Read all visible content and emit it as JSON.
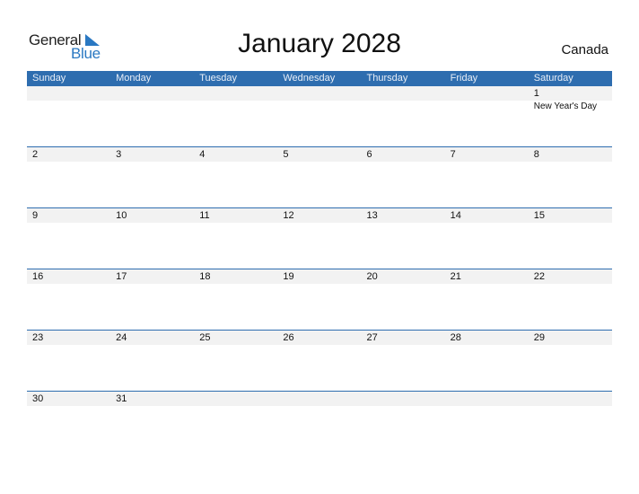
{
  "logo": {
    "general": "General",
    "blue": "Blue"
  },
  "title": "January 2028",
  "country": "Canada",
  "colors": {
    "header_bg": "#2e6daf",
    "brand_blue": "#2a78c2",
    "band": "#f2f2f2"
  },
  "weekdays": [
    "Sunday",
    "Monday",
    "Tuesday",
    "Wednesday",
    "Thursday",
    "Friday",
    "Saturday"
  ],
  "weeks": [
    [
      {
        "d": ""
      },
      {
        "d": ""
      },
      {
        "d": ""
      },
      {
        "d": ""
      },
      {
        "d": ""
      },
      {
        "d": ""
      },
      {
        "d": "1",
        "h": "New Year's Day"
      }
    ],
    [
      {
        "d": "2"
      },
      {
        "d": "3"
      },
      {
        "d": "4"
      },
      {
        "d": "5"
      },
      {
        "d": "6"
      },
      {
        "d": "7"
      },
      {
        "d": "8"
      }
    ],
    [
      {
        "d": "9"
      },
      {
        "d": "10"
      },
      {
        "d": "11"
      },
      {
        "d": "12"
      },
      {
        "d": "13"
      },
      {
        "d": "14"
      },
      {
        "d": "15"
      }
    ],
    [
      {
        "d": "16"
      },
      {
        "d": "17"
      },
      {
        "d": "18"
      },
      {
        "d": "19"
      },
      {
        "d": "20"
      },
      {
        "d": "21"
      },
      {
        "d": "22"
      }
    ],
    [
      {
        "d": "23"
      },
      {
        "d": "24"
      },
      {
        "d": "25"
      },
      {
        "d": "26"
      },
      {
        "d": "27"
      },
      {
        "d": "28"
      },
      {
        "d": "29"
      }
    ],
    [
      {
        "d": "30"
      },
      {
        "d": "31"
      },
      {
        "d": ""
      },
      {
        "d": ""
      },
      {
        "d": ""
      },
      {
        "d": ""
      },
      {
        "d": ""
      }
    ]
  ]
}
